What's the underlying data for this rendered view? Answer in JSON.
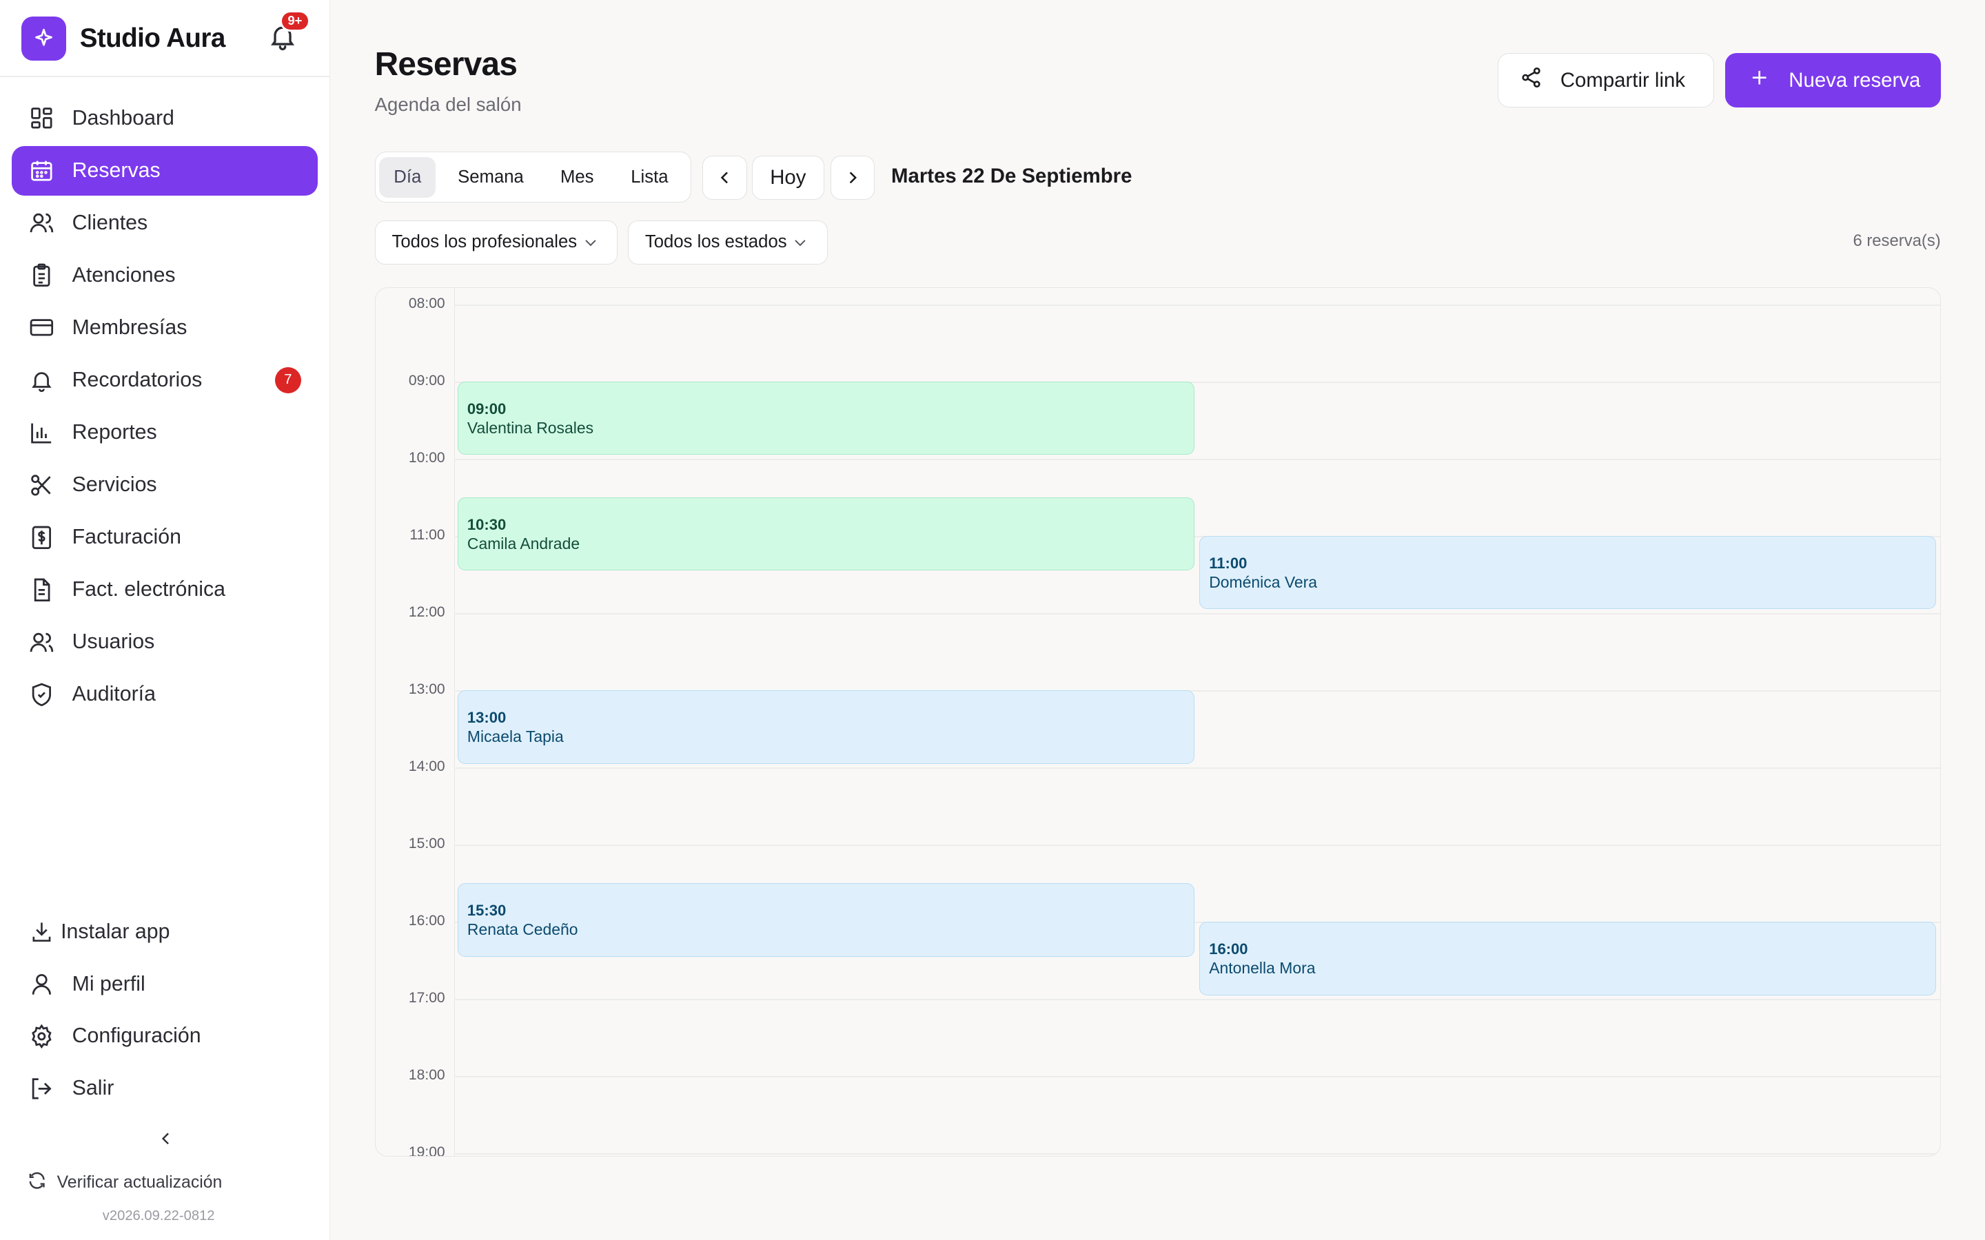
{
  "app": {
    "name": "Studio Aura",
    "notifications_badge": "9+"
  },
  "sidebar": {
    "items": [
      {
        "label": "Dashboard",
        "icon": "dashboard-icon"
      },
      {
        "label": "Reservas",
        "icon": "calendar-icon",
        "active": true
      },
      {
        "label": "Clientes",
        "icon": "users-icon"
      },
      {
        "label": "Atenciones",
        "icon": "clipboard-icon"
      },
      {
        "label": "Membresías",
        "icon": "card-icon"
      },
      {
        "label": "Recordatorios",
        "icon": "bell-icon",
        "badge": "7"
      },
      {
        "label": "Reportes",
        "icon": "bar-chart-icon"
      },
      {
        "label": "Servicios",
        "icon": "scissors-icon"
      },
      {
        "label": "Facturación",
        "icon": "receipt-icon"
      },
      {
        "label": "Fact. electrónica",
        "icon": "document-icon"
      },
      {
        "label": "Usuarios",
        "icon": "users-icon"
      },
      {
        "label": "Auditoría",
        "icon": "shield-icon"
      }
    ],
    "bottom": [
      {
        "label": "Instalar app",
        "icon": "download-icon"
      },
      {
        "label": "Mi perfil",
        "icon": "user-icon"
      },
      {
        "label": "Configuración",
        "icon": "gear-icon"
      },
      {
        "label": "Salir",
        "icon": "logout-icon"
      }
    ],
    "update_label": "Verificar actualización",
    "version": "v2026.09.22-0812"
  },
  "header": {
    "title": "Reservas",
    "subtitle": "Agenda del salón",
    "share_label": "Compartir link",
    "new_label": "Nueva reserva"
  },
  "toolbar": {
    "views": [
      "Día",
      "Semana",
      "Mes",
      "Lista"
    ],
    "active_view": "Día",
    "today_label": "Hoy",
    "current_date": "Martes 22 De Septiembre"
  },
  "filters": {
    "professional": "Todos los profesionales",
    "status": "Todos los estados",
    "count": "6 reserva(s)"
  },
  "calendar": {
    "hours": [
      "08:00",
      "09:00",
      "10:00",
      "11:00",
      "12:00",
      "13:00",
      "14:00",
      "15:00",
      "16:00",
      "17:00",
      "18:00",
      "19:00"
    ],
    "events": [
      {
        "time": "09:00",
        "name": "Valentina Rosales",
        "column": 0,
        "color": "green"
      },
      {
        "time": "10:30",
        "name": "Camila Andrade",
        "column": 0,
        "color": "green"
      },
      {
        "time": "11:00",
        "name": "Doménica Vera",
        "column": 1,
        "color": "blue"
      },
      {
        "time": "13:00",
        "name": "Micaela Tapia",
        "column": 0,
        "color": "blue"
      },
      {
        "time": "15:30",
        "name": "Renata Cedeño",
        "column": 0,
        "color": "blue"
      },
      {
        "time": "16:00",
        "name": "Antonella Mora",
        "column": 1,
        "color": "blue"
      }
    ]
  },
  "colors": {
    "accent": "#7c3aed",
    "badge": "#dc2626",
    "event_green": "#d1fae5",
    "event_blue": "#dff0fc"
  }
}
